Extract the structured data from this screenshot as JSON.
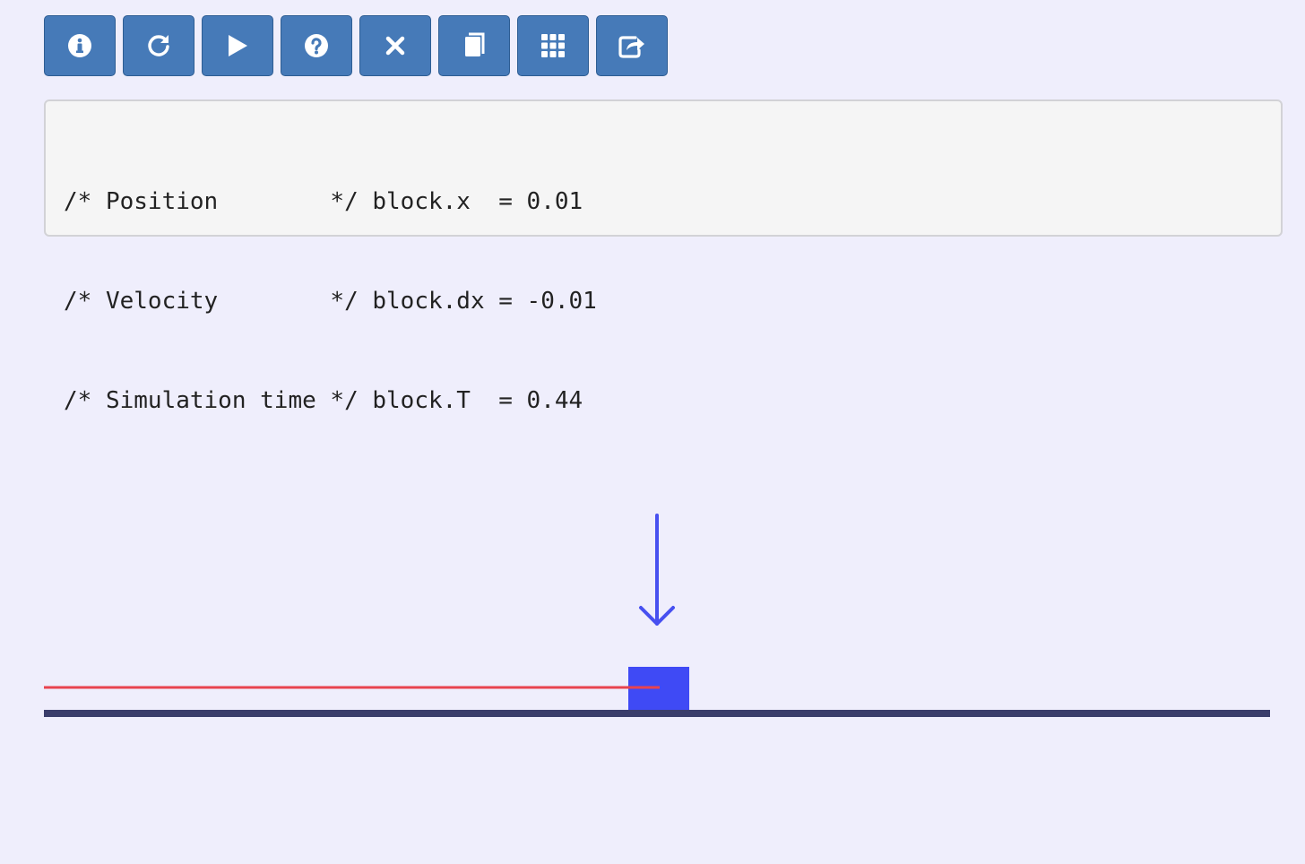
{
  "toolbar": {
    "buttons": [
      {
        "icon": "info-icon",
        "name": "info-button"
      },
      {
        "icon": "reload-icon",
        "name": "reset-button"
      },
      {
        "icon": "play-icon",
        "name": "play-button"
      },
      {
        "icon": "help-icon",
        "name": "help-button"
      },
      {
        "icon": "close-icon",
        "name": "close-button"
      },
      {
        "icon": "book-icon",
        "name": "docs-button"
      },
      {
        "icon": "grid-icon",
        "name": "apps-button"
      },
      {
        "icon": "share-icon",
        "name": "share-button"
      }
    ]
  },
  "state": {
    "lines": [
      "/* Position        */ block.x  = 0.01",
      "/* Velocity        */ block.dx = -0.01",
      "/* Simulation time */ block.T  = 0.44"
    ]
  },
  "colors": {
    "button": "#467ab8",
    "block": "#3f4af5",
    "trail": "#e8434f",
    "ground": "#3a3d6b",
    "force_arrow": "#4750f0"
  }
}
